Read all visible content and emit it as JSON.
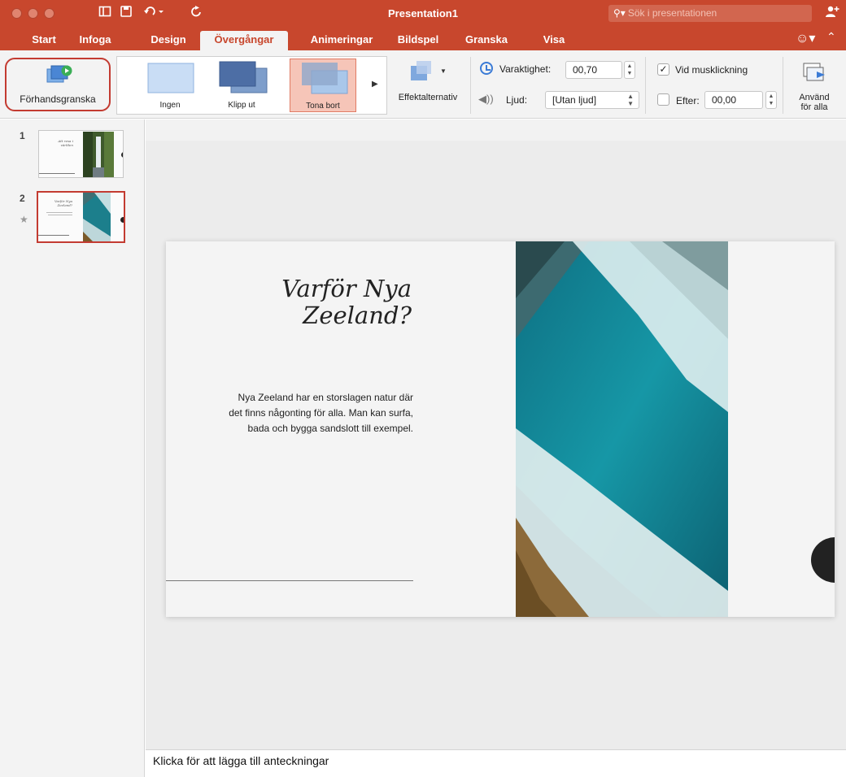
{
  "window": {
    "title": "Presentation1",
    "search_placeholder": "Sök i presentationen"
  },
  "tabs": [
    {
      "label": "Start",
      "active": false
    },
    {
      "label": "Infoga",
      "active": false
    },
    {
      "label": "Design",
      "active": false
    },
    {
      "label": "Övergångar",
      "active": true
    },
    {
      "label": "Animeringar",
      "active": false
    },
    {
      "label": "Bildspel",
      "active": false
    },
    {
      "label": "Granska",
      "active": false
    },
    {
      "label": "Visa",
      "active": false
    }
  ],
  "ribbon": {
    "preview_label": "Förhandsgranska",
    "transitions": [
      {
        "label": "Ingen",
        "selected": false
      },
      {
        "label": "Klipp ut",
        "selected": false
      },
      {
        "label": "Tona bort",
        "selected": true
      }
    ],
    "effect_options_label": "Effektalternativ",
    "duration_label": "Varaktighet:",
    "duration_value": "00,70",
    "sound_label": "Ljud:",
    "sound_value": "[Utan ljud]",
    "on_click_label": "Vid musklickning",
    "on_click_checked": true,
    "after_label": "Efter:",
    "after_value": "00,00",
    "after_checked": false,
    "apply_all_label_1": "Använd",
    "apply_all_label_2": "för alla"
  },
  "slides_panel": {
    "slides": [
      {
        "number": "1",
        "selected": false,
        "has_transition": false
      },
      {
        "number": "2",
        "selected": true,
        "has_transition": true
      }
    ]
  },
  "slide": {
    "title_line1": "Varför Nya",
    "title_line2": "Zeeland?",
    "body_line1": "Nya Zeeland har en storslagen natur där",
    "body_line2": "det finns någonting för alla. Man kan surfa,",
    "body_line3": "bada och bygga sandslott till exempel."
  },
  "notes": {
    "placeholder": "Klicka för att lägga till anteckningar"
  },
  "colors": {
    "accent": "#c8472d",
    "selection_border": "#c33b31",
    "selected_transition_fill": "#f6c5b8"
  },
  "icons": [
    "close-icon",
    "minimize-icon",
    "zoom-icon",
    "sidebar-icon",
    "save-icon",
    "undo-icon",
    "redo-icon",
    "search-icon",
    "share-icon",
    "smiley-icon",
    "collapse-icon",
    "preview-icon",
    "effect-options-icon",
    "clock-icon",
    "speaker-icon",
    "checkbox-icon",
    "apply-all-icon",
    "star-icon"
  ]
}
